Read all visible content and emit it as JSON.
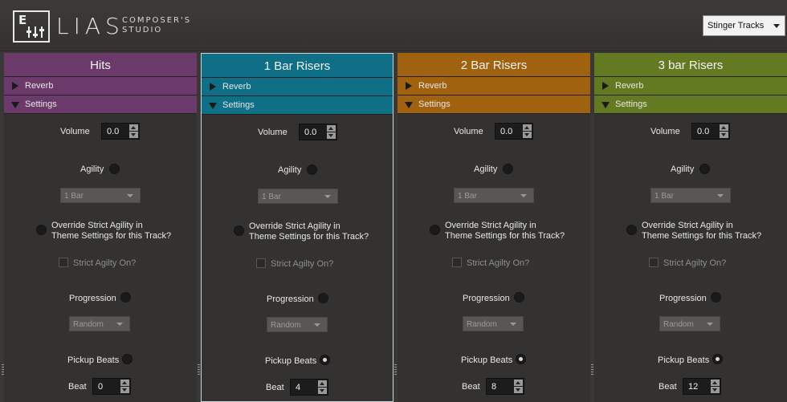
{
  "header": {
    "logo_letter": "E",
    "logo_name": "LIAS",
    "logo_sub_1": "COMPOSER'S",
    "logo_sub_2": "STUDIO",
    "track_select": "Stinger Tracks"
  },
  "panels": [
    {
      "title": "Hits",
      "color": "#6b3a6b",
      "reverb": "Reverb",
      "settings": "Settings",
      "volume_label": "Volume",
      "volume": "0.0",
      "agility_label": "Agility",
      "agility_on": false,
      "agility_bar": "1 Bar",
      "override_line1": "Override Strict Agility in",
      "override_line2": "Theme Settings for this Track?",
      "strict_label": "Strict Agilty On?",
      "progression_label": "Progression",
      "progression_value": "Random",
      "pickup_label": "Pickup Beats",
      "pickup_on": false,
      "beat_label": "Beat",
      "beat": "0"
    },
    {
      "title": "1 Bar Risers",
      "color": "#0e6f86",
      "reverb": "Reverb",
      "settings": "Settings",
      "volume_label": "Volume",
      "volume": "0.0",
      "agility_label": "Agility",
      "agility_on": false,
      "agility_bar": "1 Bar",
      "override_line1": "Override Strict Agility in",
      "override_line2": "Theme Settings for this Track?",
      "strict_label": "Strict Agilty On?",
      "progression_label": "Progression",
      "progression_value": "Random",
      "pickup_label": "Pickup Beats",
      "pickup_on": true,
      "beat_label": "Beat",
      "beat": "4"
    },
    {
      "title": "2 Bar Risers",
      "color": "#a0620f",
      "reverb": "Reverb",
      "settings": "Settings",
      "volume_label": "Volume",
      "volume": "0.0",
      "agility_label": "Agility",
      "agility_on": false,
      "agility_bar": "1 Bar",
      "override_line1": "Override Strict Agility in",
      "override_line2": "Theme Settings for this Track?",
      "strict_label": "Strict Agilty On?",
      "progression_label": "Progression",
      "progression_value": "Random",
      "pickup_label": "Pickup Beats",
      "pickup_on": true,
      "beat_label": "Beat",
      "beat": "8"
    },
    {
      "title": "3 bar Risers",
      "color": "#647a22",
      "reverb": "Reverb",
      "settings": "Settings",
      "volume_label": "Volume",
      "volume": "0.0",
      "agility_label": "Agility",
      "agility_on": false,
      "agility_bar": "1 Bar",
      "override_line1": "Override Strict Agility in",
      "override_line2": "Theme Settings for this Track?",
      "strict_label": "Strict Agilty On?",
      "progression_label": "Progression",
      "progression_value": "Random",
      "pickup_label": "Pickup Beats",
      "pickup_on": true,
      "beat_label": "Beat",
      "beat": "12"
    }
  ]
}
